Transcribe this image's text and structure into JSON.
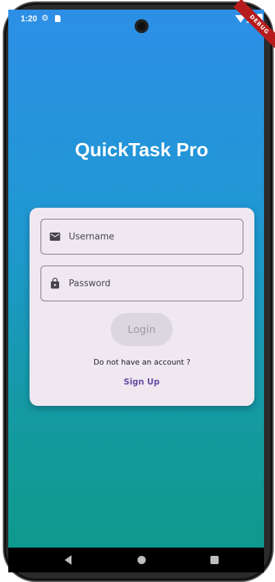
{
  "status_bar": {
    "time": "1:20"
  },
  "debug_banner": "DEBUG",
  "app": {
    "title": "QuickTask Pro"
  },
  "login_form": {
    "username_placeholder": "Username",
    "password_placeholder": "Password",
    "login_label": "Login",
    "account_prompt": "Do not have an account ?",
    "signup_label": "Sign Up"
  },
  "colors": {
    "gradient_top": "#2d8fe6",
    "gradient_bottom": "#0e9a8e",
    "card_background": "#efe8f1",
    "link_color": "#6a4fa3"
  },
  "icons": {
    "username": "mail-icon",
    "password": "lock-icon",
    "nav_back": "back-triangle-icon",
    "nav_home": "home-circle-icon",
    "nav_recents": "recents-square-icon"
  }
}
